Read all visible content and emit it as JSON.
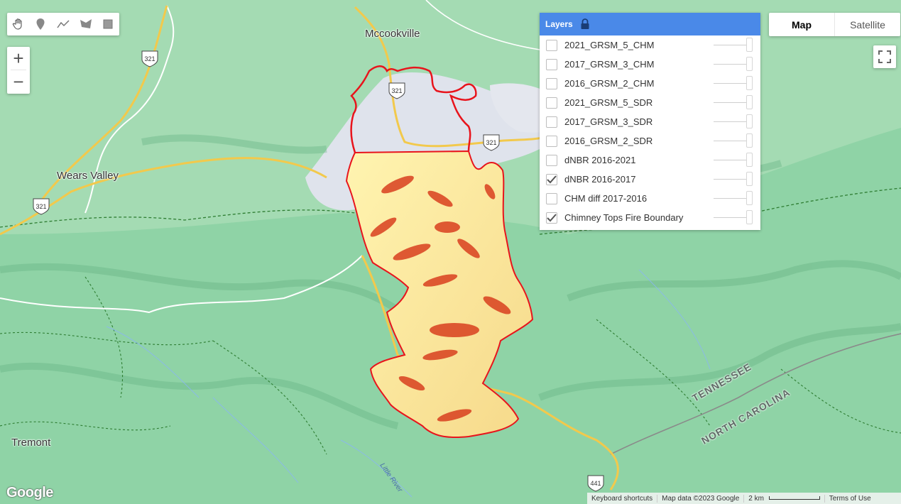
{
  "map": {
    "place_labels": [
      "Mccookville",
      "Wears Valley",
      "Tremont"
    ],
    "state_labels": [
      "TENNESSEE",
      "NORTH CAROLINA"
    ],
    "route_shields": [
      "321",
      "321",
      "321",
      "321",
      "441"
    ],
    "river_label": "Little River",
    "colors": {
      "terrain": "#8fd3a6",
      "urban": "#dfe3ec",
      "fire_boundary": "#e8141c",
      "burn_low": "#fff2a8",
      "burn_high": "#d9401f",
      "road_major": "#f2c94c",
      "road_minor": "#ffffff",
      "park_boundary": "#2e7d32"
    }
  },
  "draw_tools": {
    "icons": [
      "hand-pan-icon",
      "marker-pin-icon",
      "polyline-icon",
      "polygon-icon",
      "rectangle-icon"
    ]
  },
  "zoom": {
    "in_label": "+",
    "out_label": "−"
  },
  "map_type": {
    "map_label": "Map",
    "satellite_label": "Satellite",
    "active": "Map"
  },
  "layers_panel": {
    "title": "Layers",
    "items": [
      {
        "label": "2021_GRSM_5_CHM",
        "checked": false
      },
      {
        "label": "2017_GRSM_3_CHM",
        "checked": false
      },
      {
        "label": "2016_GRSM_2_CHM",
        "checked": false
      },
      {
        "label": "2021_GRSM_5_SDR",
        "checked": false
      },
      {
        "label": "2017_GRSM_3_SDR",
        "checked": false
      },
      {
        "label": "2016_GRSM_2_SDR",
        "checked": false
      },
      {
        "label": "dNBR 2016-2021",
        "checked": false
      },
      {
        "label": "dNBR 2016-2017",
        "checked": true
      },
      {
        "label": "CHM diff 2017-2016",
        "checked": false
      },
      {
        "label": "Chimney Tops Fire Boundary",
        "checked": true
      }
    ]
  },
  "footer": {
    "logo": "Google",
    "keyboard_shortcuts": "Keyboard shortcuts",
    "map_data": "Map data ©2023 Google",
    "scale": "2 km",
    "terms": "Terms of Use"
  }
}
